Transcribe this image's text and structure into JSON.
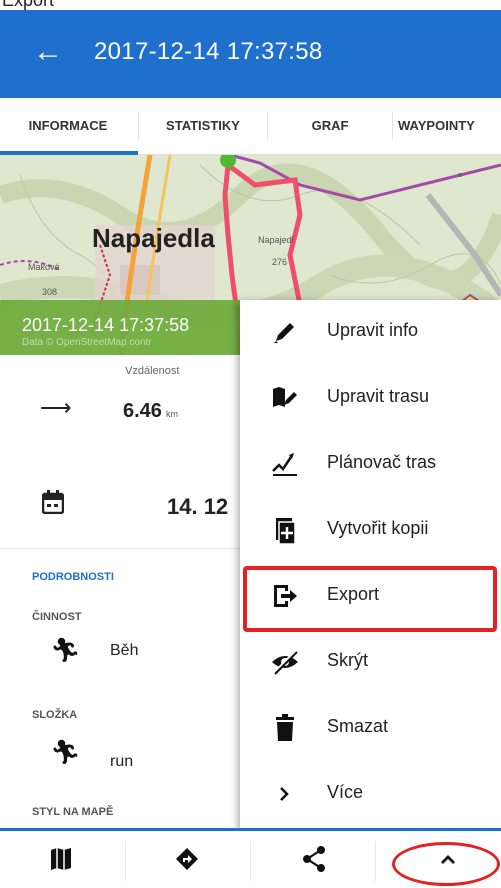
{
  "caption": "Export",
  "appbar": {
    "title": "2017-12-14 17:37:58"
  },
  "tabs": [
    {
      "label": "INFORMACE"
    },
    {
      "label": "STATISTIKY"
    },
    {
      "label": "GRAF"
    },
    {
      "label": "WAYPOINTY"
    }
  ],
  "map": {
    "town": "Napajedla",
    "small_labels": [
      "Napajedl",
      "Maková",
      "308",
      "276"
    ],
    "banner_text": "2017-12-14 17:37:58",
    "attribution": "Data © OpenStreetMap contr"
  },
  "stats": {
    "distance_label": "Vzdálenost",
    "distance_value": "6.46",
    "distance_unit": "km",
    "date_value": "14. 12"
  },
  "details": {
    "section_title": "PODROBNOSTI",
    "activity_label": "ČINNOST",
    "activity_value": "Běh",
    "folder_label": "SLOŽKA",
    "folder_value": "run",
    "style_label": "STYL NA MAPĚ"
  },
  "menu": {
    "items": [
      {
        "label": "Upravit info",
        "icon": "pencil-icon"
      },
      {
        "label": "Upravit trasu",
        "icon": "edit-route-icon"
      },
      {
        "label": "Plánovač tras",
        "icon": "route-planner-icon"
      },
      {
        "label": "Vytvořit kopii",
        "icon": "copy-icon"
      },
      {
        "label": "Export",
        "icon": "export-icon"
      },
      {
        "label": "Skrýt",
        "icon": "eye-off-icon"
      },
      {
        "label": "Smazat",
        "icon": "trash-icon"
      },
      {
        "label": "Více",
        "icon": "chevron-right-icon"
      }
    ]
  },
  "bottom_bar": {
    "buttons": [
      "map-icon",
      "navigate-icon",
      "share-icon",
      "chevron-up-icon"
    ]
  },
  "colors": {
    "primary": "#1f6fcc",
    "highlight": "#e32222",
    "map_banner": "#6eaa3c"
  }
}
